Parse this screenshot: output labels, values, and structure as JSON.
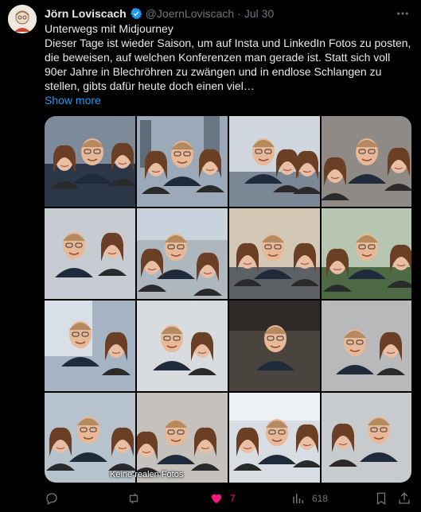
{
  "tweet": {
    "author_name": "Jörn Loviscach",
    "handle": "@JoernLoviscach",
    "separator": "·",
    "time": "Jul 30",
    "line1": "Unterwegs mit Midjourney",
    "line2": "Dieser Tage ist wieder Saison, um auf Insta und LinkedIn Fotos zu posten, die beweisen, auf welchen Konferenzen man gerade ist. Statt sich voll 90er Jahre in Blechröhren zu zwängen und in endlose Schlangen zu stellen, gibts dafür heute doch einen viel…",
    "show_more": "Show more",
    "media_caption": "Keine realen Fotos"
  },
  "actions": {
    "reply_count": "",
    "retweet_count": "",
    "like_count": "7",
    "views_count": "618"
  },
  "colors": {
    "background": "#000000",
    "text": "#e7e9ea",
    "muted": "#71767b",
    "link": "#1d9bf0",
    "like": "#f91880",
    "verified": "#1d9bf0"
  },
  "icons": [
    "verified-badge-icon",
    "more-options-icon",
    "reply-icon",
    "retweet-icon",
    "like-heart-icon",
    "views-icon",
    "bookmark-icon",
    "share-icon"
  ]
}
